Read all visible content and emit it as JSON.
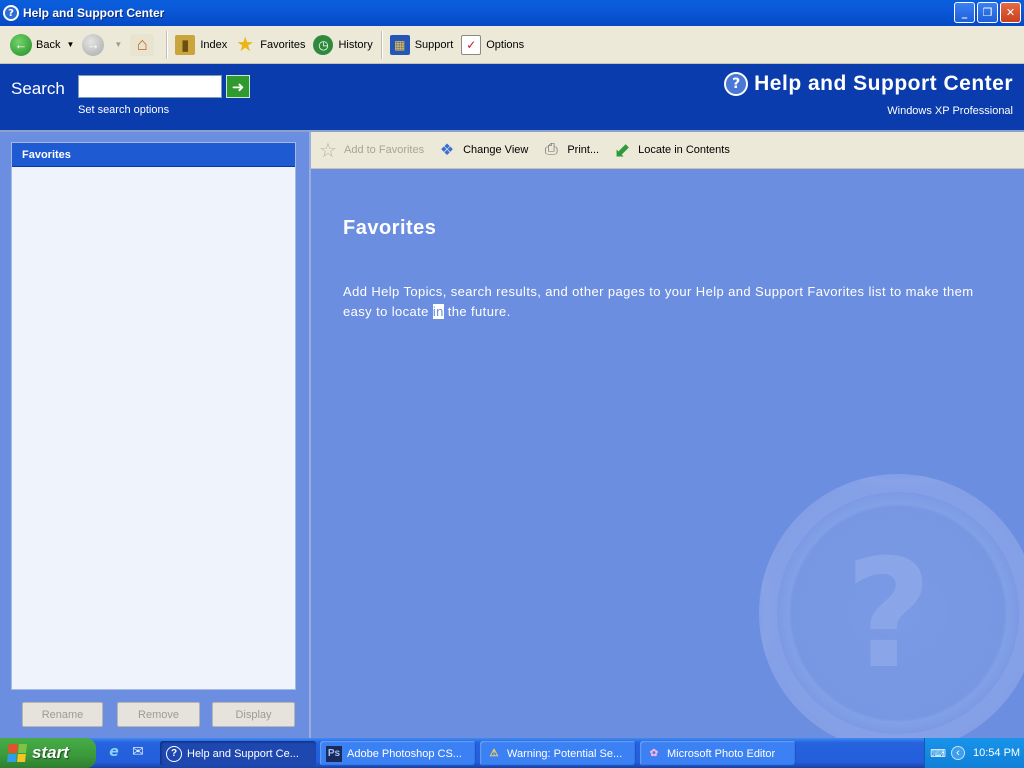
{
  "window": {
    "title": "Help and Support Center"
  },
  "toolbar": {
    "back_label": "Back",
    "index_label": "Index",
    "favorites_label": "Favorites",
    "history_label": "History",
    "support_label": "Support",
    "options_label": "Options"
  },
  "header": {
    "search_label": "Search",
    "search_value": "",
    "search_options": "Set search options",
    "app_title": "Help and Support Center",
    "app_subtitle": "Windows XP Professional"
  },
  "left_pane": {
    "panel_title": "Favorites",
    "rename_label": "Rename",
    "remove_label": "Remove",
    "display_label": "Display"
  },
  "content_toolbar": {
    "add_favorites_label": "Add to Favorites",
    "change_view_label": "Change View",
    "print_label": "Print...",
    "locate_label": "Locate in Contents"
  },
  "content": {
    "title": "Favorites",
    "text_before": "Add Help Topics, search results, and other pages to your Help and Support Favorites list to make them easy to locate ",
    "text_highlight": "in",
    "text_after": " the future."
  },
  "taskbar": {
    "start_label": "start",
    "tasks": [
      {
        "label": "Help and Support Ce...",
        "icon": "help-icon"
      },
      {
        "label": "Adobe Photoshop CS...",
        "icon": "photoshop-icon"
      },
      {
        "label": "Warning: Potential Se...",
        "icon": "warning-icon"
      },
      {
        "label": "Microsoft Photo Editor",
        "icon": "photo-editor-icon"
      }
    ],
    "clock": "10:54 PM"
  },
  "colors": {
    "title_bar": "#0a5fdc",
    "header_band": "#0a3cae",
    "content_bg": "#6c8ee0",
    "toolbar_bg": "#ece9d8",
    "start_green": "#3b983b"
  }
}
